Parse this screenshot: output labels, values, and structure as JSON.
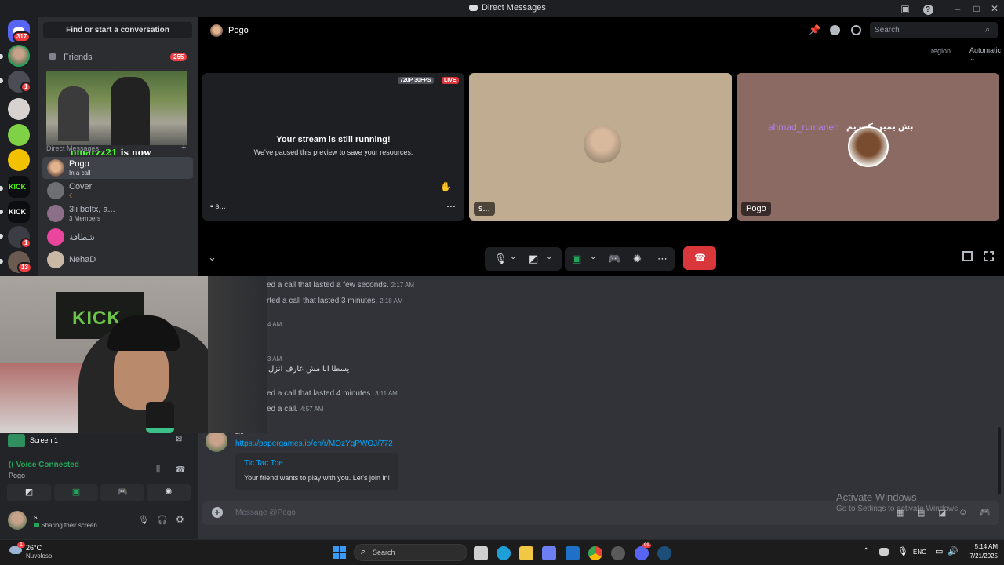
{
  "window": {
    "title": "Direct Messages",
    "icons": [
      "inbox-icon",
      "help-icon",
      "minimize-icon",
      "maximize-icon",
      "close-icon"
    ]
  },
  "rail": {
    "home_badge": "317",
    "servers": [
      {
        "name": "server-1",
        "badge": ""
      },
      {
        "name": "server-2",
        "badge": "1"
      },
      {
        "name": "server-3",
        "badge": ""
      },
      {
        "name": "server-4",
        "badge": ""
      },
      {
        "name": "server-5",
        "badge": ""
      },
      {
        "name": "kick-1",
        "label": "KICK"
      },
      {
        "name": "kick-2",
        "label": "KICK"
      },
      {
        "name": "server-8",
        "badge": "1"
      },
      {
        "name": "server-9",
        "badge": "13"
      }
    ]
  },
  "sidebar": {
    "find_button": "Find or start a conversation",
    "friends_label": "Friends",
    "friends_badge": "255",
    "section_label": "Direct Messages",
    "dms": [
      {
        "name": "Pogo",
        "sub": "In a call"
      },
      {
        "name": "Cover",
        "sub": "☾"
      },
      {
        "name": "3li boltx, a...",
        "sub": "3 Members"
      },
      {
        "name": "شطاقة",
        "sub": ""
      },
      {
        "name": "NehaD",
        "sub": ""
      }
    ],
    "stream_overlay": {
      "user": "omarzz21",
      "text": "is now following!"
    }
  },
  "header": {
    "channel_name": "Pogo",
    "search_placeholder": "Search",
    "region_label": "region",
    "region_value": "Automatic"
  },
  "call": {
    "stream_tile": {
      "quality": "720P 30FPS",
      "live": "LIVE",
      "title": "Your stream is still running!",
      "subtitle": "We've paused this preview to save your resources.",
      "label": "s..."
    },
    "tile2_label": "s...",
    "tile3_label": "Pogo",
    "tile3_overlay_user": "ahmad_rumaneh",
    "tile3_overlay_text": "بش يمين كت يم"
  },
  "messages": [
    {
      "text": "ed a call that lasted a few seconds.",
      "time": "2:17 AM"
    },
    {
      "text": "rted a call that lasted 3 minutes.",
      "time": "2:18 AM"
    },
    {
      "text": "",
      "time": "4 AM"
    },
    {
      "text": "",
      "time": "3 AM"
    },
    {
      "text": "يسطا انا مش عارف انزل",
      "time": ""
    },
    {
      "text": "ed a call that lasted 4 minutes.",
      "time": "3:11 AM"
    },
    {
      "text": "ed a call.",
      "time": "4:57 AM"
    }
  ],
  "link_message": {
    "author": "s...",
    "url": "https://papergames.io/en/r/MOzYgPWOJ/772",
    "embed_title": "Tic Tac Toe",
    "embed_desc": "Your friend wants to play with you. Let's join in!"
  },
  "composer": {
    "placeholder": "Message @Pogo"
  },
  "activate": {
    "line1": "Activate Windows",
    "line2": "Go to Settings to activate Windows."
  },
  "voice_panel": {
    "screen_label": "Screen 1",
    "status": "Voice Connected",
    "channel": "Pogo",
    "user_name": "s...",
    "user_status": "Sharing their screen"
  },
  "taskbar": {
    "weather_temp": "26°C",
    "weather_desc": "Nuvoloso",
    "weather_badge": "1",
    "search_label": "Search",
    "lang": "ENG",
    "time": "5:14 AM",
    "date": "7/21/2025",
    "discord_badge": "99"
  },
  "colors": {
    "accent": "#5865f2",
    "danger": "#da373c",
    "online": "#23a55a",
    "link": "#00a8fc",
    "stream_name": "#b57ee8",
    "follow": "#4eff2e",
    "kick": "#53fc18"
  }
}
